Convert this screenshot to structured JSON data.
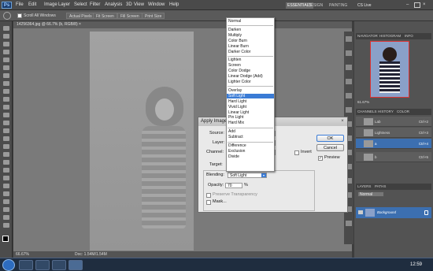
{
  "app": {
    "menu": [
      "File",
      "Edit",
      "Image",
      "Layer",
      "Select",
      "Filter",
      "Analysis",
      "3D",
      "View",
      "Window",
      "Help"
    ],
    "zoom_badge": "100%",
    "workspaces": [
      "ESSENTIALS",
      "DESIGN",
      "PAINTING"
    ],
    "cs_live": "CS Live"
  },
  "options_bar": {
    "scroll_all": "Scroll All Windows",
    "buttons": [
      "Actual Pixels",
      "Fit Screen",
      "Fill Screen",
      "Print Size"
    ]
  },
  "document": {
    "tab": "14256364.jpg @ 66.7% (b, RGB/8) ×",
    "zoom": "66.67%",
    "doc_size": "Doc: 1.54M/1.54M"
  },
  "panels": {
    "nav_tabs": [
      "NAVIGATOR",
      "HISTOGRAM",
      "INFO"
    ],
    "nav_zoom": "61.67%",
    "channel_tabs": [
      "CHANNELS",
      "HISTORY",
      "COLOR"
    ],
    "channels": [
      {
        "name": "Lab",
        "key": "Ctrl+2"
      },
      {
        "name": "Lightness",
        "key": "Ctrl+3"
      },
      {
        "name": "a",
        "key": "Ctrl+4"
      },
      {
        "name": "b",
        "key": "Ctrl+5"
      }
    ],
    "layer_tabs": [
      "LAYERS",
      "PATHS"
    ],
    "layer_mode": "Normal",
    "layer_name": "Background"
  },
  "blend_modes": {
    "groups": [
      [
        "Normal"
      ],
      [
        "Darken",
        "Multiply",
        "Color Burn",
        "Linear Burn",
        "Darker Color"
      ],
      [
        "Lighten",
        "Screen",
        "Color Dodge",
        "Linear Dodge (Add)",
        "Lighter Color"
      ],
      [
        "Overlay",
        "Soft Light",
        "Hard Light",
        "Vivid Light",
        "Linear Light",
        "Pin Light",
        "Hard Mix"
      ],
      [
        "Add",
        "Subtract"
      ],
      [
        "Difference",
        "Exclusion",
        "Divide"
      ]
    ],
    "selected": "Soft Light"
  },
  "dialog": {
    "title": "Apply Image",
    "source_label": "Source:",
    "layer_label": "Layer:",
    "channel_label": "Channel:",
    "invert_label": "Invert",
    "target_label": "Target:",
    "blending_label": "Blending:",
    "blending_value": "Soft Light",
    "opacity_label": "Opacity:",
    "opacity_value": "70",
    "opacity_unit": "%",
    "preserve_label": "Preserve Transparency",
    "mask_label": "Mask...",
    "ok": "OK",
    "cancel": "Cancel",
    "preview": "Preview"
  },
  "taskbar": {
    "clock": "12:59"
  }
}
